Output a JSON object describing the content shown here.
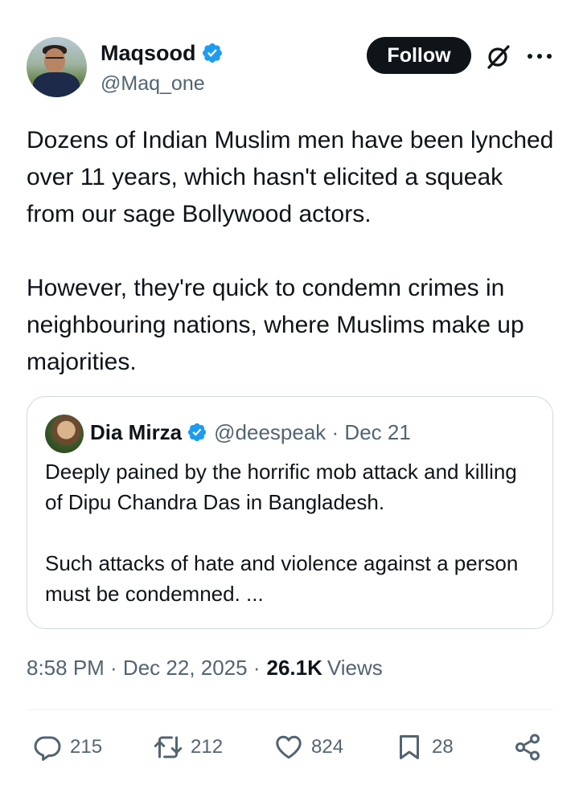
{
  "author": {
    "name": "Maqsood",
    "handle": "@Maq_one",
    "follow_label": "Follow"
  },
  "tweet": {
    "text": "Dozens of Indian Muslim men have been lynched over 11 years, which hasn't elicited a squeak from our sage Bollywood actors.\n\nHowever, they're quick to condemn crimes in neighbouring nations, where Muslims make up majorities."
  },
  "quote": {
    "name": "Dia Mirza",
    "handle_date": "@deespeak · Dec 21",
    "text": "Deeply pained by the horrific mob attack and killing of Dipu Chandra Das in Bangladesh.\n\nSuch attacks of hate and violence against a person must be condemned. ..."
  },
  "meta": {
    "time_date": "8:58 PM · Dec 22, 2025 ·",
    "views_count": "26.1K",
    "views_label": "Views"
  },
  "actions": {
    "replies": "215",
    "reposts": "212",
    "likes": "824",
    "bookmarks": "28"
  },
  "icons": {
    "verified": "verified-badge-icon",
    "grok": "grok-icon",
    "more": "more-icon",
    "reply": "reply-icon",
    "repost": "repost-icon",
    "like": "heart-icon",
    "bookmark": "bookmark-icon",
    "share": "share-icon"
  },
  "colors": {
    "accent": "#1d9bf0",
    "text": "#0f1419",
    "secondary": "#536471",
    "border": "#cfd9de"
  }
}
